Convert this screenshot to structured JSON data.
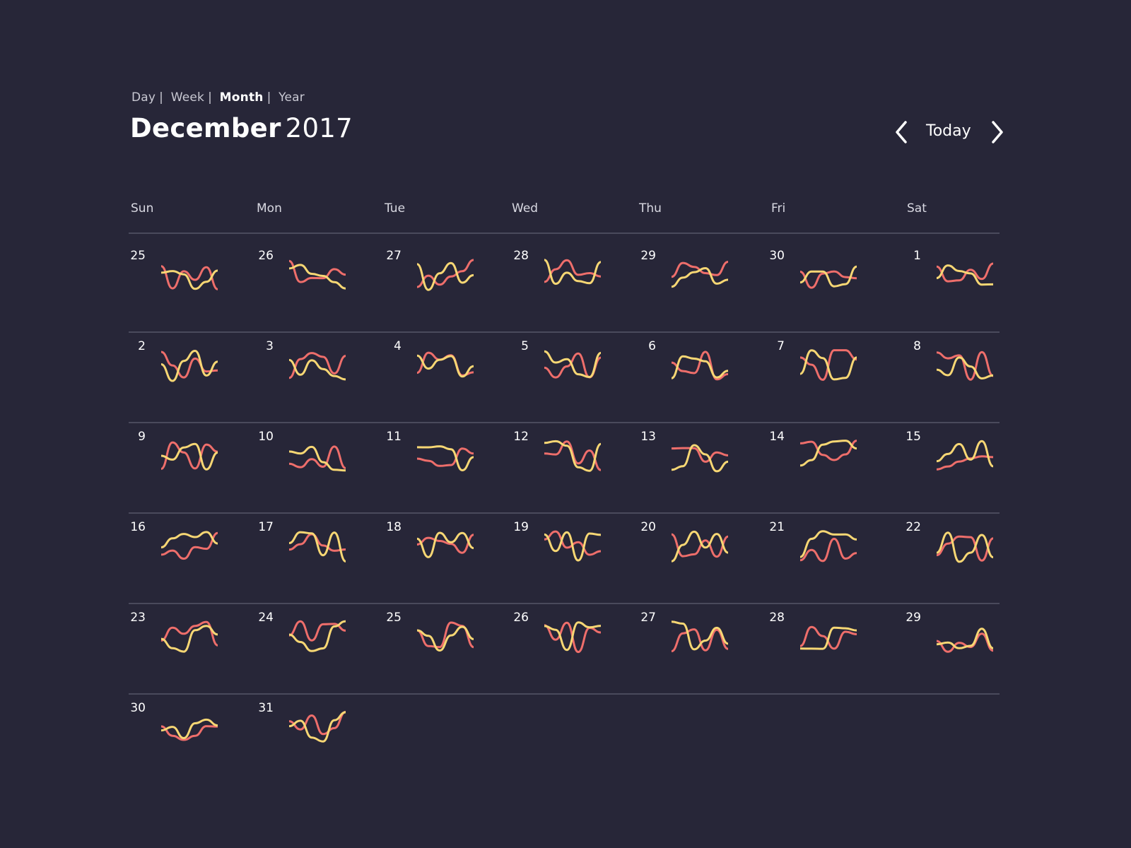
{
  "view_switcher": {
    "options": [
      "Day",
      "Week",
      "Month",
      "Year"
    ],
    "active": "Month"
  },
  "header": {
    "month": "December",
    "year": "2017",
    "today_label": "Today",
    "prev_icon": "chevron-left-icon",
    "next_icon": "chevron-right-icon"
  },
  "weekdays": [
    "Sun",
    "Mon",
    "Tue",
    "Wed",
    "Thu",
    "Fri",
    "Sat"
  ],
  "colors": {
    "background": "#272638",
    "line_red": "#ee6e6b",
    "line_yellow": "#f7d774",
    "divider": "#4a4a5c"
  },
  "weeks": [
    [
      "25",
      "26",
      "27",
      "28",
      "29",
      "30",
      "1"
    ],
    [
      "2",
      "3",
      "4",
      "5",
      "6",
      "7",
      "8"
    ],
    [
      "9",
      "10",
      "11",
      "12",
      "13",
      "14",
      "15"
    ],
    [
      "16",
      "17",
      "18",
      "19",
      "20",
      "21",
      "22"
    ],
    [
      "23",
      "24",
      "25",
      "26",
      "27",
      "28",
      "29"
    ],
    [
      "30",
      "31"
    ]
  ]
}
